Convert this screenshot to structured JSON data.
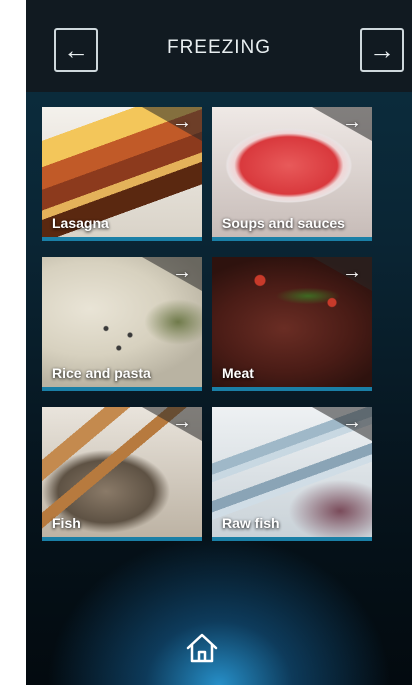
{
  "header": {
    "title": "FREEZING",
    "back_icon": "arrow-left-icon",
    "forward_icon": "arrow-right-icon"
  },
  "categories": [
    {
      "label": "Lasagna",
      "icon": "arrow-right-icon"
    },
    {
      "label": "Soups and sauces",
      "icon": "arrow-right-icon"
    },
    {
      "label": "Rice and pasta",
      "icon": "arrow-right-icon"
    },
    {
      "label": "Meat",
      "icon": "arrow-right-icon"
    },
    {
      "label": "Fish",
      "icon": "arrow-right-icon"
    },
    {
      "label": "Raw fish",
      "icon": "arrow-right-icon"
    }
  ],
  "footer": {
    "home_icon": "home-icon"
  },
  "colors": {
    "accent": "#1a7fa6",
    "background": "#0a2534",
    "header": "#111a21"
  }
}
